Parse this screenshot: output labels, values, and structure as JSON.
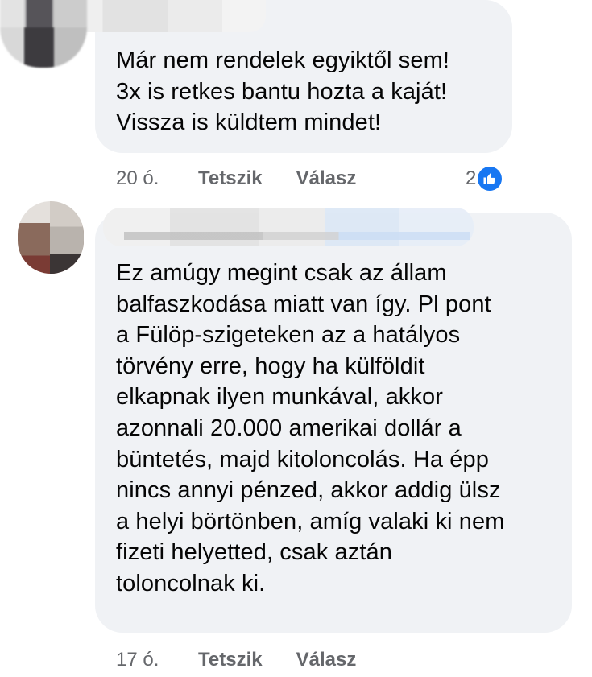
{
  "comments": [
    {
      "text": "Már nem rendelek egyiktől sem!\n3x is retkes bantu hozta a kaját!\nVissza is küldtem mindet!",
      "time": "20 ó.",
      "like_label": "Tetszik",
      "reply_label": "Válasz",
      "reaction_count": "2",
      "reaction_icon": "thumbs-up-icon"
    },
    {
      "text": "Ez amúgy megint csak az állam\nbalfaszkodása miatt van így. Pl pont\na Fülöp-szigeteken az a hatályos\ntörvény erre, hogy ha külföldit\nelkapnak ilyen munkával, akkor\nazonnali 20.000 amerikai dollár a\nbüntetés, majd kitoloncolás. Ha épp\nnincs annyi pénzed, akkor addig ülsz\na helyi börtönben, amíg valaki ki nem\nfizeti helyetted, csak aztán\ntoloncolnak ki.",
      "time": "17 ó.",
      "like_label": "Tetszik",
      "reply_label": "Válasz"
    }
  ],
  "colors": {
    "bubble": "#f0f2f5",
    "meta_text": "#65676b",
    "like_blue": "#1877f2"
  }
}
